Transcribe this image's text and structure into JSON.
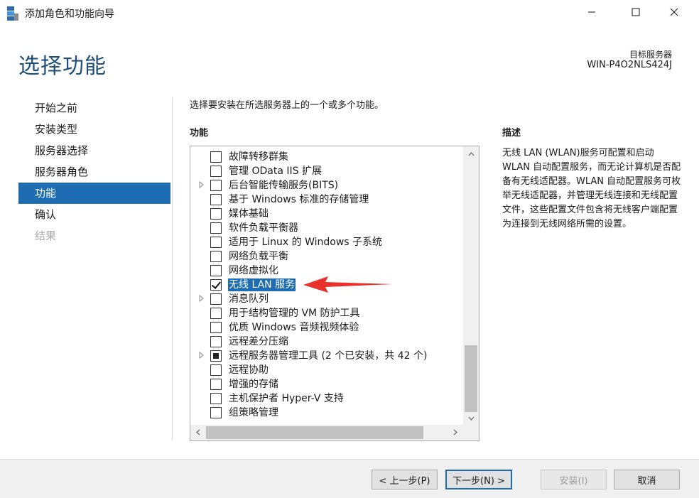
{
  "window": {
    "title": "添加角色和功能向导",
    "app_icon": "server-manager-icon",
    "controls": {
      "minimize_icon": "minimize-icon",
      "maximize_icon": "maximize-icon",
      "close_icon": "close-icon"
    }
  },
  "header": {
    "page_title": "选择功能",
    "target_label": "目标服务器",
    "target_name": "WIN-P4O2NLS424J"
  },
  "nav": {
    "items": [
      {
        "label": "开始之前",
        "state": "normal"
      },
      {
        "label": "安装类型",
        "state": "normal"
      },
      {
        "label": "服务器选择",
        "state": "normal"
      },
      {
        "label": "服务器角色",
        "state": "normal"
      },
      {
        "label": "功能",
        "state": "active"
      },
      {
        "label": "确认",
        "state": "normal"
      },
      {
        "label": "结果",
        "state": "disabled"
      }
    ]
  },
  "main": {
    "instruction": "选择要安装在所选服务器上的一个或多个功能。",
    "features_label": "功能",
    "features": [
      {
        "label": "故障转移群集",
        "state": "unchecked",
        "expandable": false,
        "selected": false
      },
      {
        "label": "管理 OData IIS 扩展",
        "state": "unchecked",
        "expandable": false,
        "selected": false
      },
      {
        "label": "后台智能传输服务(BITS)",
        "state": "unchecked",
        "expandable": true,
        "selected": false
      },
      {
        "label": "基于 Windows 标准的存储管理",
        "state": "unchecked",
        "expandable": false,
        "selected": false
      },
      {
        "label": "媒体基础",
        "state": "unchecked",
        "expandable": false,
        "selected": false
      },
      {
        "label": "软件负载平衡器",
        "state": "unchecked",
        "expandable": false,
        "selected": false
      },
      {
        "label": "适用于 Linux 的 Windows 子系统",
        "state": "unchecked",
        "expandable": false,
        "selected": false
      },
      {
        "label": "网络负载平衡",
        "state": "unchecked",
        "expandable": false,
        "selected": false
      },
      {
        "label": "网络虚拟化",
        "state": "unchecked",
        "expandable": false,
        "selected": false
      },
      {
        "label": "无线 LAN 服务",
        "state": "checked",
        "expandable": false,
        "selected": true
      },
      {
        "label": "消息队列",
        "state": "unchecked",
        "expandable": true,
        "selected": false
      },
      {
        "label": "用于结构管理的 VM 防护工具",
        "state": "unchecked",
        "expandable": false,
        "selected": false
      },
      {
        "label": "优质 Windows 音频视频体验",
        "state": "unchecked",
        "expandable": false,
        "selected": false
      },
      {
        "label": "远程差分压缩",
        "state": "unchecked",
        "expandable": false,
        "selected": false
      },
      {
        "label": "远程服务器管理工具 (2 个已安装，共 42 个)",
        "state": "partial",
        "expandable": true,
        "selected": false
      },
      {
        "label": "远程协助",
        "state": "unchecked",
        "expandable": false,
        "selected": false
      },
      {
        "label": "增强的存储",
        "state": "unchecked",
        "expandable": false,
        "selected": false
      },
      {
        "label": "主机保护者 Hyper-V 支持",
        "state": "unchecked",
        "expandable": false,
        "selected": false
      },
      {
        "label": "组策略管理",
        "state": "unchecked",
        "expandable": false,
        "selected": false
      }
    ],
    "vertical_scroll_position": 0.75,
    "annotation_color": "#e8312a"
  },
  "description": {
    "title": "描述",
    "text": "无线 LAN (WLAN)服务可配置和启动 WLAN 自动配置服务，而无论计算机是否配备有无线适配器。WLAN 自动配置服务可枚举无线适配器，并管理无线连接和无线配置文件，这些配置文件包含将无线客户端配置为连接到无线网络所需的设置。"
  },
  "footer": {
    "prev_label": "< 上一步(P)",
    "next_label": "下一步(N) >",
    "install_label": "安装(I)",
    "cancel_label": "取消"
  },
  "colors": {
    "accent": "#1e6db3",
    "title": "#1e4e79"
  }
}
